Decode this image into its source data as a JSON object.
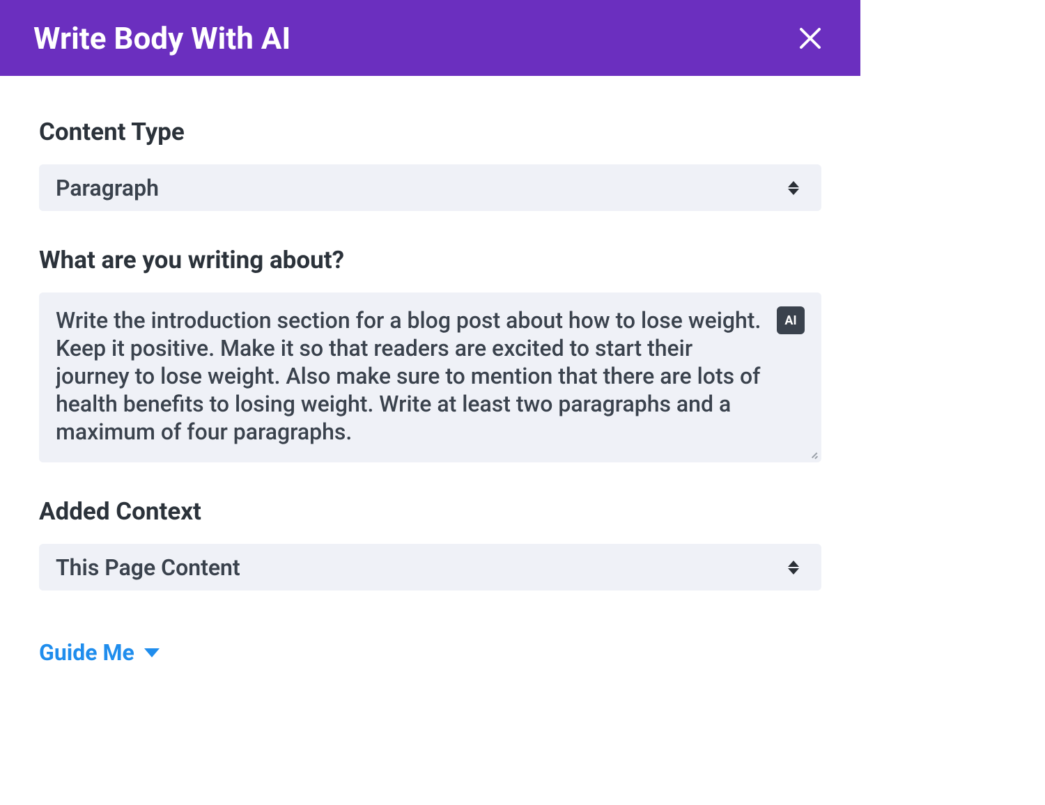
{
  "header": {
    "title": "Write Body With AI"
  },
  "fields": {
    "contentType": {
      "label": "Content Type",
      "value": "Paragraph"
    },
    "writingAbout": {
      "label": "What are you writing about?",
      "value": "Write the introduction section for a blog post about how to lose weight. Keep it positive. Make it so that readers are excited to start their journey to lose weight. Also make sure to mention that there are lots of health benefits to losing weight. Write at least two paragraphs and a maximum of four paragraphs.",
      "aiBadge": "AI"
    },
    "addedContext": {
      "label": "Added Context",
      "value": "This Page Content"
    }
  },
  "guideMe": {
    "label": "Guide Me"
  }
}
